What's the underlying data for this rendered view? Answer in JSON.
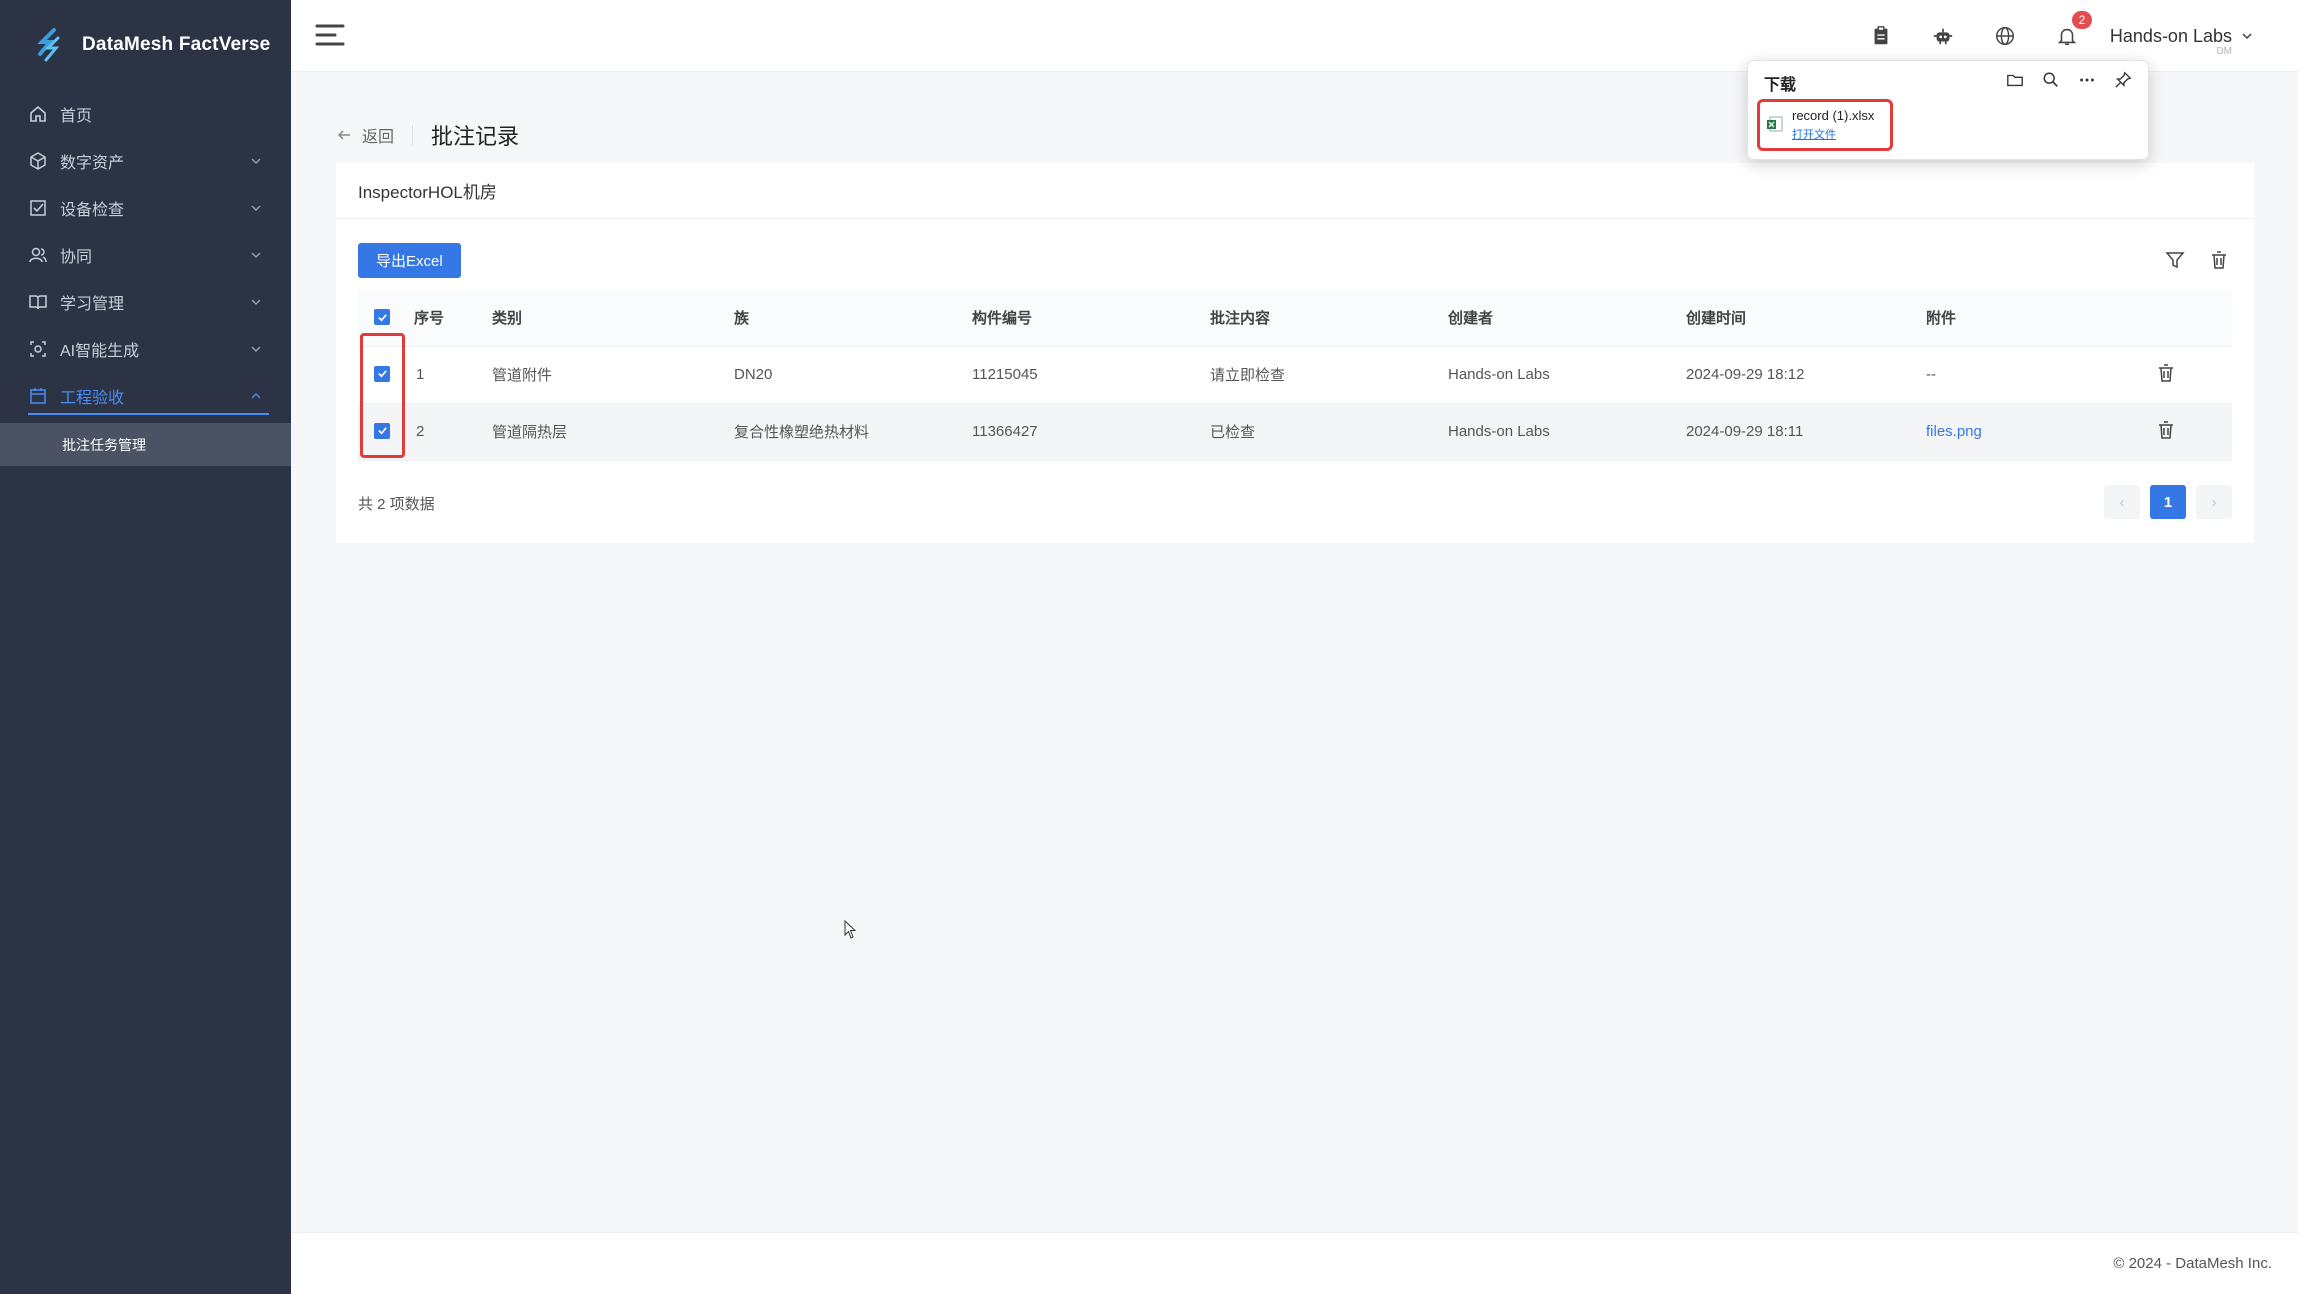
{
  "app": {
    "name": "DataMesh FactVerse",
    "accent": "#3577e5",
    "sidebar_bg": "#2b3345"
  },
  "sidebar": {
    "items": [
      {
        "label": "首页",
        "icon": "home-icon"
      },
      {
        "label": "数字资产",
        "icon": "cube-icon"
      },
      {
        "label": "设备检查",
        "icon": "checkbox-icon"
      },
      {
        "label": "协同",
        "icon": "users-icon"
      },
      {
        "label": "学习管理",
        "icon": "book-icon"
      },
      {
        "label": "AI智能生成",
        "icon": "ai-icon"
      },
      {
        "label": "工程验收",
        "icon": "calendar-icon"
      }
    ],
    "active_label": "工程验收",
    "subitem": "批注任务管理"
  },
  "header": {
    "notification_count": "2",
    "user_name": "Hands-on Labs",
    "user_sub": "DM"
  },
  "download": {
    "title": "下载",
    "file_name": "record (1).xlsx",
    "open_label": "打开文件"
  },
  "page": {
    "back_label": "返回",
    "title": "批注记录",
    "card_title": "InspectorHOL机房",
    "export_label": "导出Excel",
    "total_label": "共 2 项数据",
    "current_page": "1"
  },
  "table": {
    "columns": [
      "序号",
      "类别",
      "族",
      "构件编号",
      "批注内容",
      "创建者",
      "创建时间",
      "附件"
    ],
    "rows": [
      {
        "no": "1",
        "category": "管道附件",
        "family": "DN20",
        "part_no": "11215045",
        "content": "请立即检查",
        "creator": "Hands-on Labs",
        "time": "2024-09-29 18:12",
        "attachment": "--"
      },
      {
        "no": "2",
        "category": "管道隔热层",
        "family": "复合性橡塑绝热材料",
        "part_no": "11366427",
        "content": "已检查",
        "creator": "Hands-on Labs",
        "time": "2024-09-29 18:11",
        "attachment": "files.png"
      }
    ]
  },
  "footer": {
    "copyright": "© 2024 - DataMesh Inc."
  }
}
